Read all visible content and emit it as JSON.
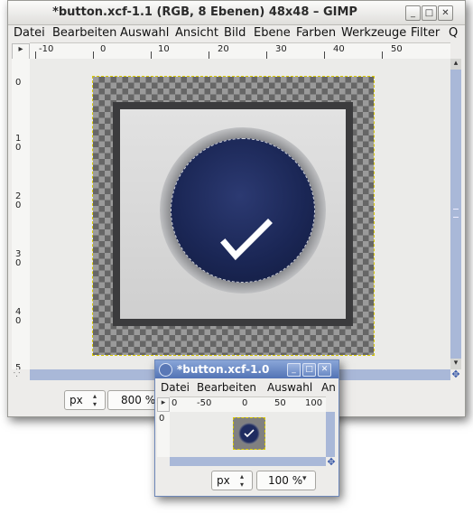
{
  "main_window": {
    "title": "*button.xcf-1.1 (RGB, 8 Ebenen) 48x48 – GIMP",
    "controls": {
      "minimize": "_",
      "maximize": "□",
      "close": "✕"
    },
    "menu": [
      "Datei",
      "Bearbeiten",
      "Auswahl",
      "Ansicht",
      "Bild",
      "Ebene",
      "Farben",
      "Werkzeuge",
      "Filter",
      "Q"
    ],
    "ruler_h_labels": [
      "-10",
      "0",
      "10",
      "20",
      "30",
      "40",
      "50"
    ],
    "ruler_v_labels": [
      "0",
      "1\n0",
      "2\n0",
      "3\n0",
      "4\n0",
      "5"
    ],
    "unit": "px",
    "zoom": "800 %"
  },
  "second_window": {
    "title": "*button.xcf-1.0",
    "controls": {
      "minimize": "_",
      "maximize": "□",
      "close": "✕"
    },
    "menu": [
      "Datei",
      "Bearbeiten",
      "Auswahl",
      "An"
    ],
    "ruler_h_labels": [
      "0",
      "-50",
      "0",
      "50",
      "100"
    ],
    "ruler_v_label": "0",
    "unit": "px",
    "zoom": "100 %"
  },
  "icons": {
    "move": "move-cross-icon",
    "spin": "spin-arrows-icon",
    "dropdown": "chevron-down-icon",
    "navigate": "navigate-icon"
  },
  "colors": {
    "accent": "#5273b5",
    "scrollbar": "#a9b8d8",
    "disc": "#1b2756"
  }
}
